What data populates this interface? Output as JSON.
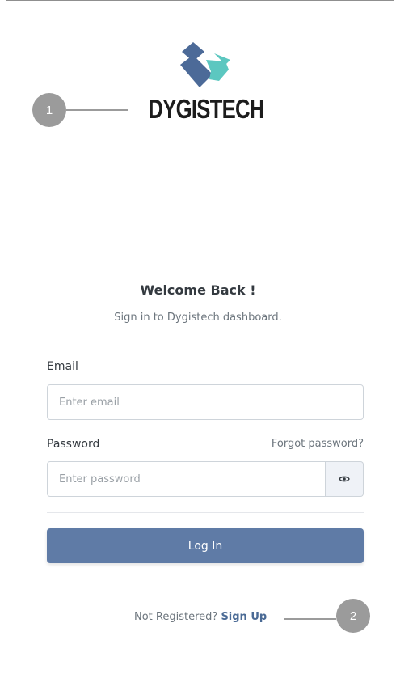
{
  "brand": {
    "name": "DYGISTECH"
  },
  "callouts": {
    "one": "1",
    "two": "2"
  },
  "login": {
    "title": "Welcome Back !",
    "subtitle": "Sign in to Dygistech dashboard.",
    "email_label": "Email",
    "email_placeholder": "Enter email",
    "password_label": "Password",
    "forgot_link": "Forgot password?",
    "password_placeholder": "Enter password",
    "login_button": "Log In",
    "signup_prompt": "Not Registered?",
    "signup_link": "Sign Up"
  },
  "icons": {
    "logo": "dygistech-logo-icon",
    "password_toggle": "eye-icon"
  },
  "colors": {
    "primary": "#5f7ba6",
    "logo_dark": "#4c6a98",
    "logo_accent": "#5cc7c0",
    "callout": "#9b9b9b"
  }
}
